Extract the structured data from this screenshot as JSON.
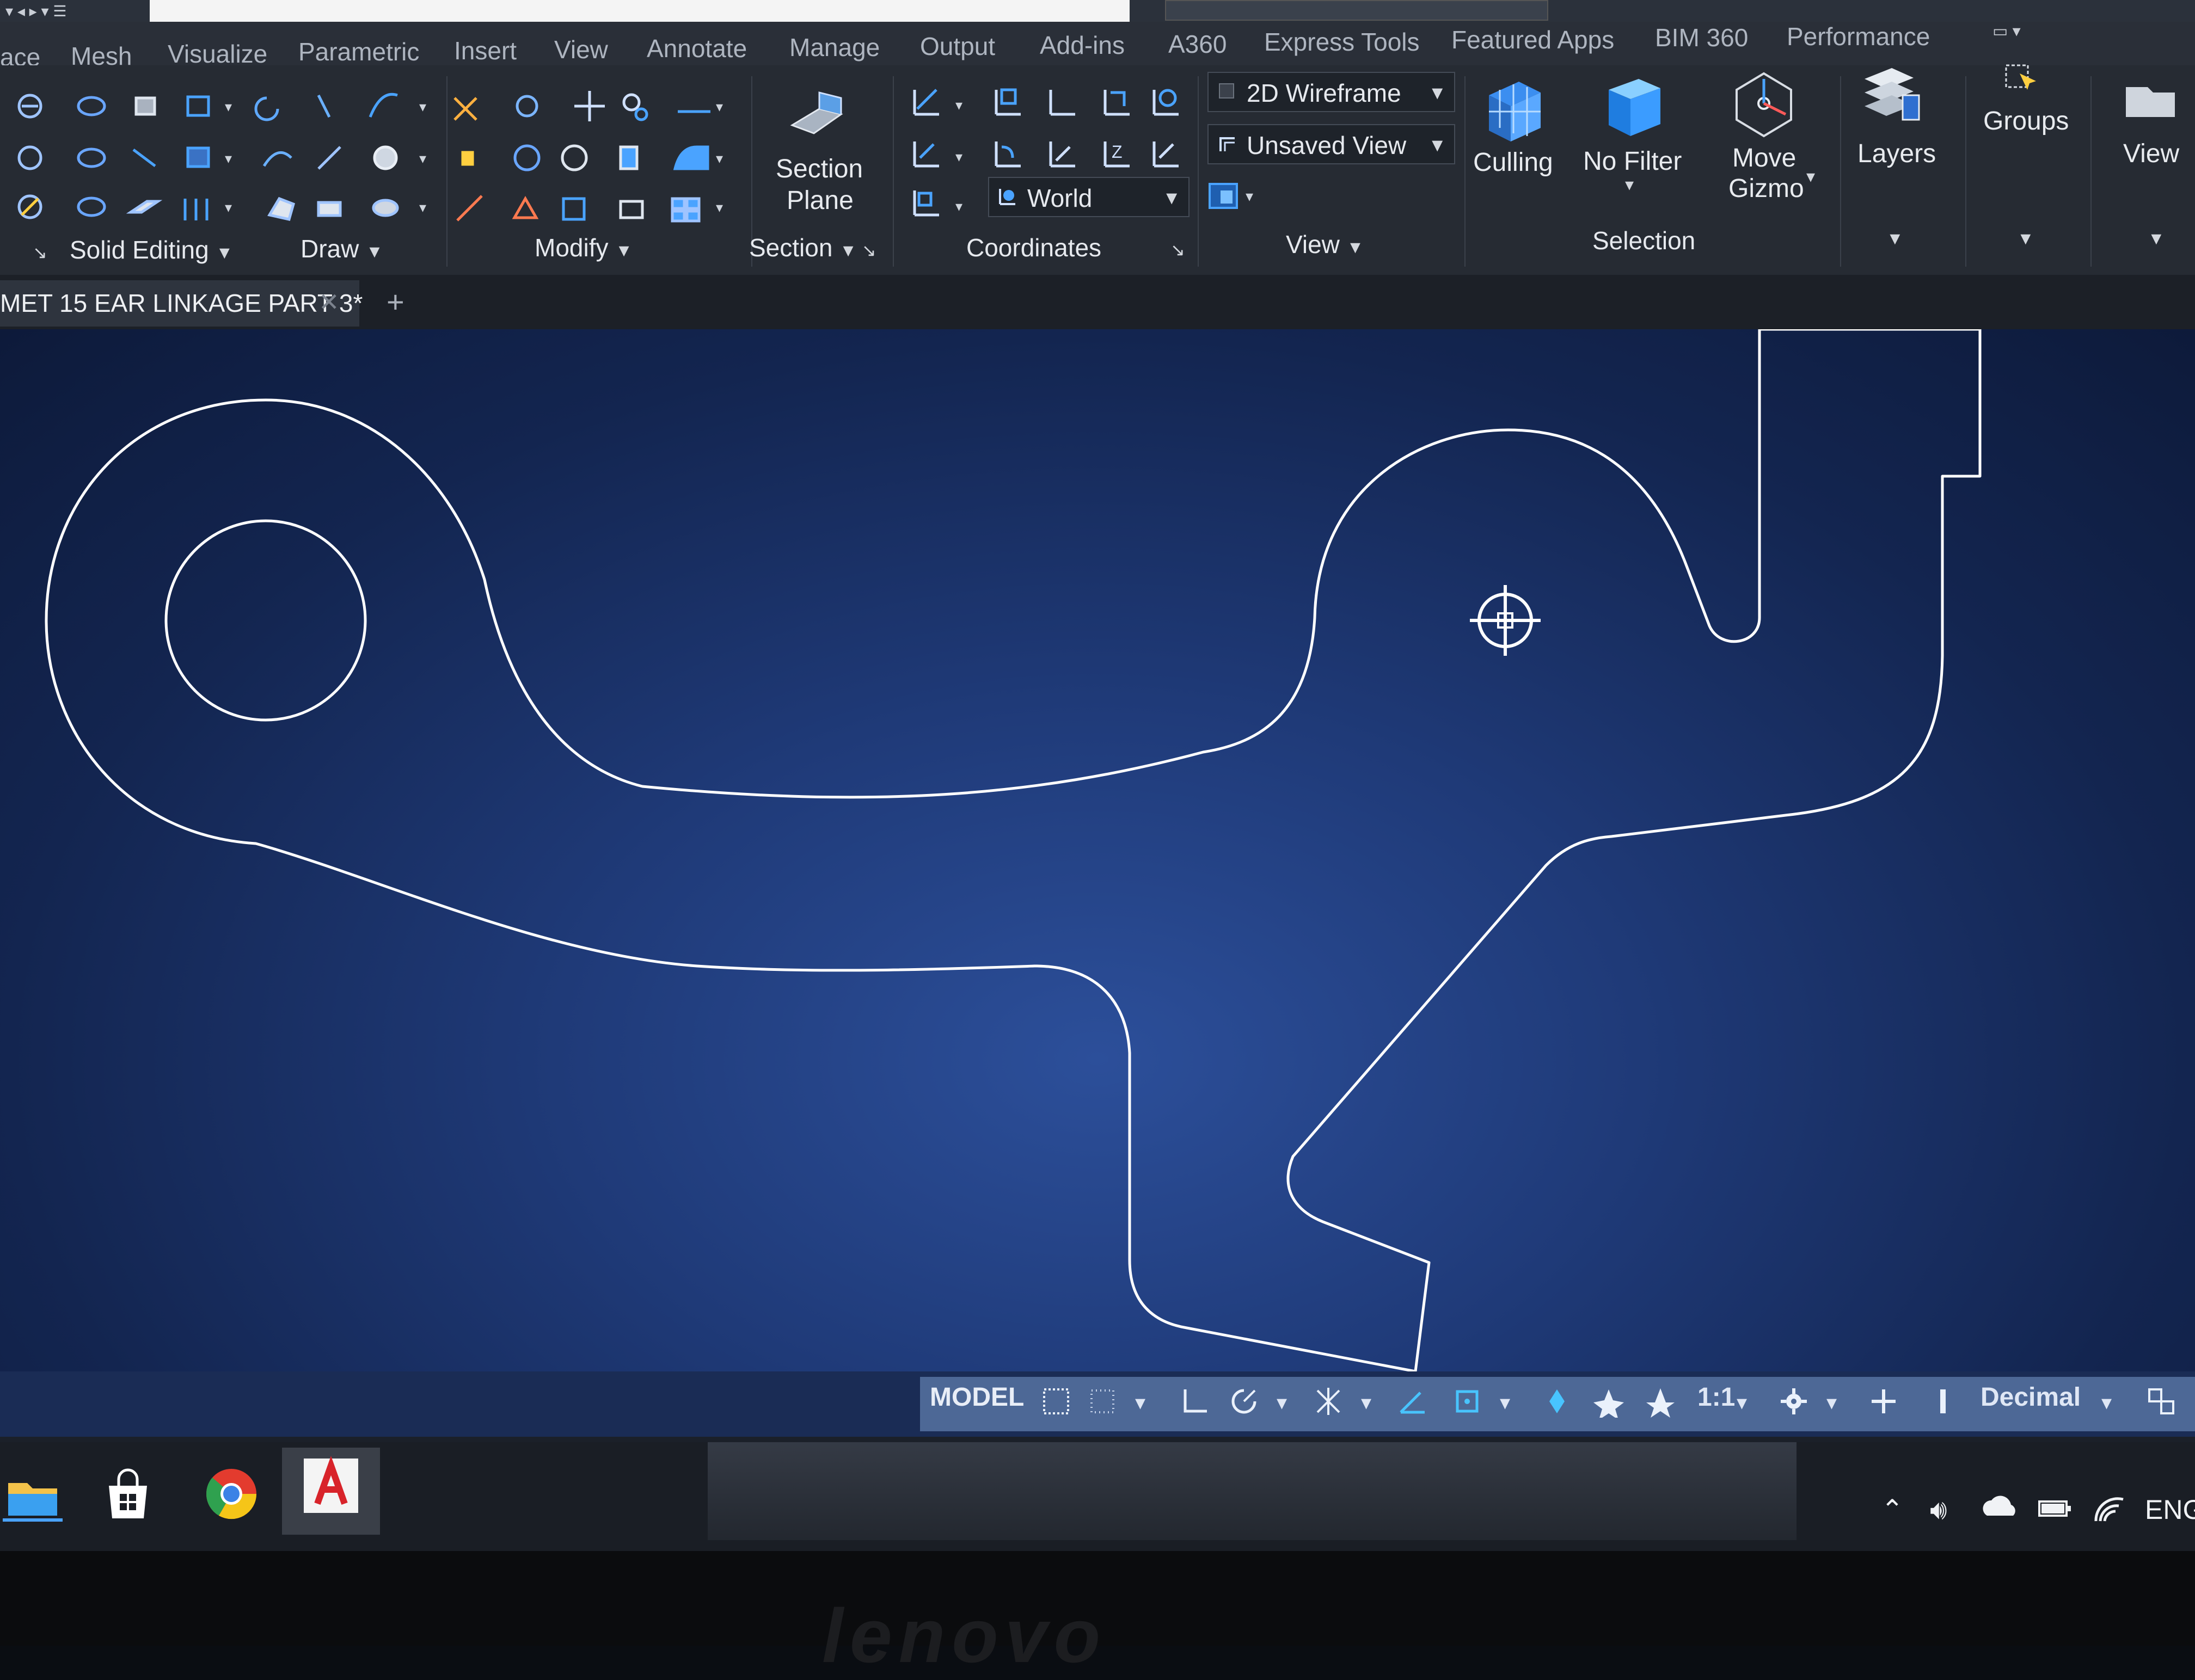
{
  "app": {
    "document_tab": "MET 15 EAR LINKAGE PART 3*",
    "new_tab_symbol": "+",
    "close_symbol": "✕"
  },
  "menu": {
    "tabs": [
      "ace",
      "Mesh",
      "Visualize",
      "Parametric",
      "Insert",
      "View",
      "Annotate",
      "Manage",
      "Output",
      "Add-ins",
      "A360",
      "Express Tools",
      "Featured Apps",
      "BIM 360",
      "Performance"
    ]
  },
  "ribbon": {
    "panels": {
      "solid_editing": "Solid Editing",
      "draw": "Draw",
      "modify": "Modify",
      "section": "Section",
      "coordinates": "Coordinates",
      "view": "View",
      "selection": "Selection"
    },
    "buttons": {
      "section_plane_line1": "Section",
      "section_plane_line2": "Plane",
      "culling": "Culling",
      "no_filter": "No Filter",
      "move_gizmo_line1": "Move",
      "move_gizmo_line2": "Gizmo",
      "layers": "Layers",
      "groups": "Groups",
      "view": "View"
    },
    "dropdowns": {
      "visual_style": "2D Wireframe",
      "named_view": "Unsaved View",
      "ucs": "World"
    }
  },
  "statusbar": {
    "model": "MODEL",
    "scale": "1:1",
    "units": "Decimal"
  },
  "taskbar": {
    "apps": [
      "file-explorer",
      "store",
      "chrome",
      "autocad"
    ],
    "language": "ENG"
  },
  "bezel": {
    "brand": "lenovo"
  },
  "colors": {
    "ribbon_bg": "#262b33",
    "canvas_center": "#2c4f9a",
    "canvas_edge": "#0d1a3a",
    "linework": "#ffffff",
    "status_bar": "#4d6896",
    "accent_blue": "#4aa3ff"
  }
}
